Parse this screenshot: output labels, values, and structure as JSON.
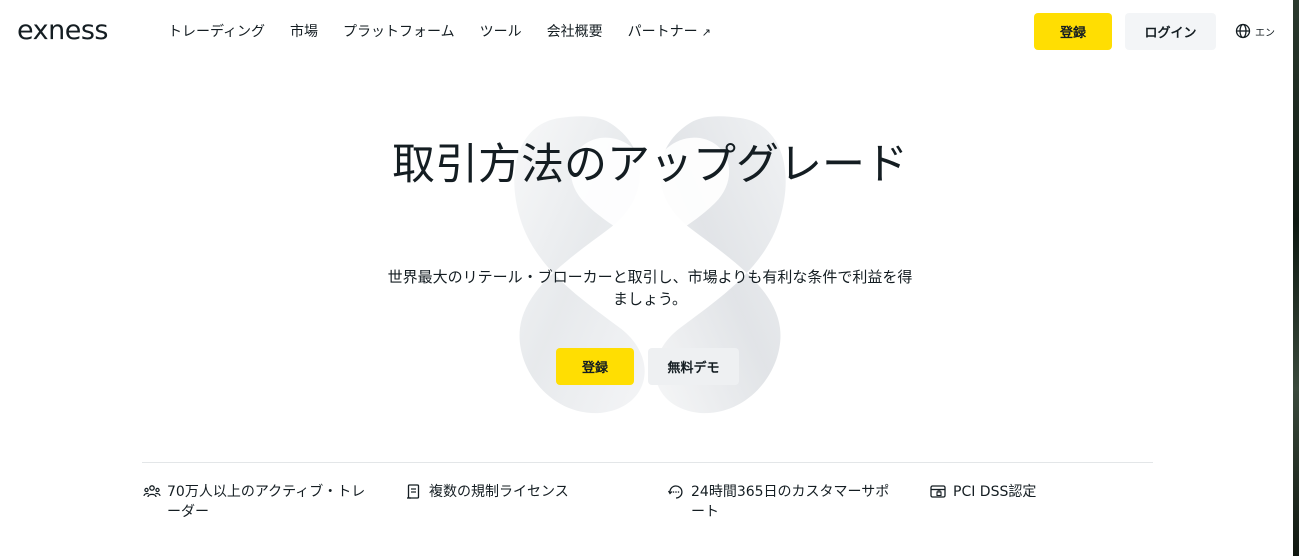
{
  "header": {
    "logo": "exness",
    "nav": [
      {
        "label": "トレーディング"
      },
      {
        "label": "市場"
      },
      {
        "label": "プラットフォーム"
      },
      {
        "label": "ツール"
      },
      {
        "label": "会社概要"
      },
      {
        "label": "パートナー",
        "external_icon": "arrow-up-right-icon"
      }
    ],
    "register_label": "登録",
    "login_label": "ログイン",
    "language_label": "エン",
    "language_icon": "globe-icon"
  },
  "hero": {
    "title": "取引方法のアップグレード",
    "subtitle": "世界最大のリテール・ブローカーと取引し、市場よりも有利な条件で利益を得ましょう。",
    "register_label": "登録",
    "demo_label": "無料デモ"
  },
  "features": [
    {
      "icon": "users-icon",
      "text": "70万人以上のアクティブ・トレーダー"
    },
    {
      "icon": "license-document-icon",
      "text": "複数の規制ライセンス"
    },
    {
      "icon": "support-headset-icon",
      "text": "24時間365日のカスタマーサポート"
    },
    {
      "icon": "secure-card-icon",
      "text": "PCI DSS認定"
    }
  ],
  "colors": {
    "accent_yellow": "#ffde02",
    "text_dark": "#141d22",
    "button_gray": "#f3f5f7"
  }
}
